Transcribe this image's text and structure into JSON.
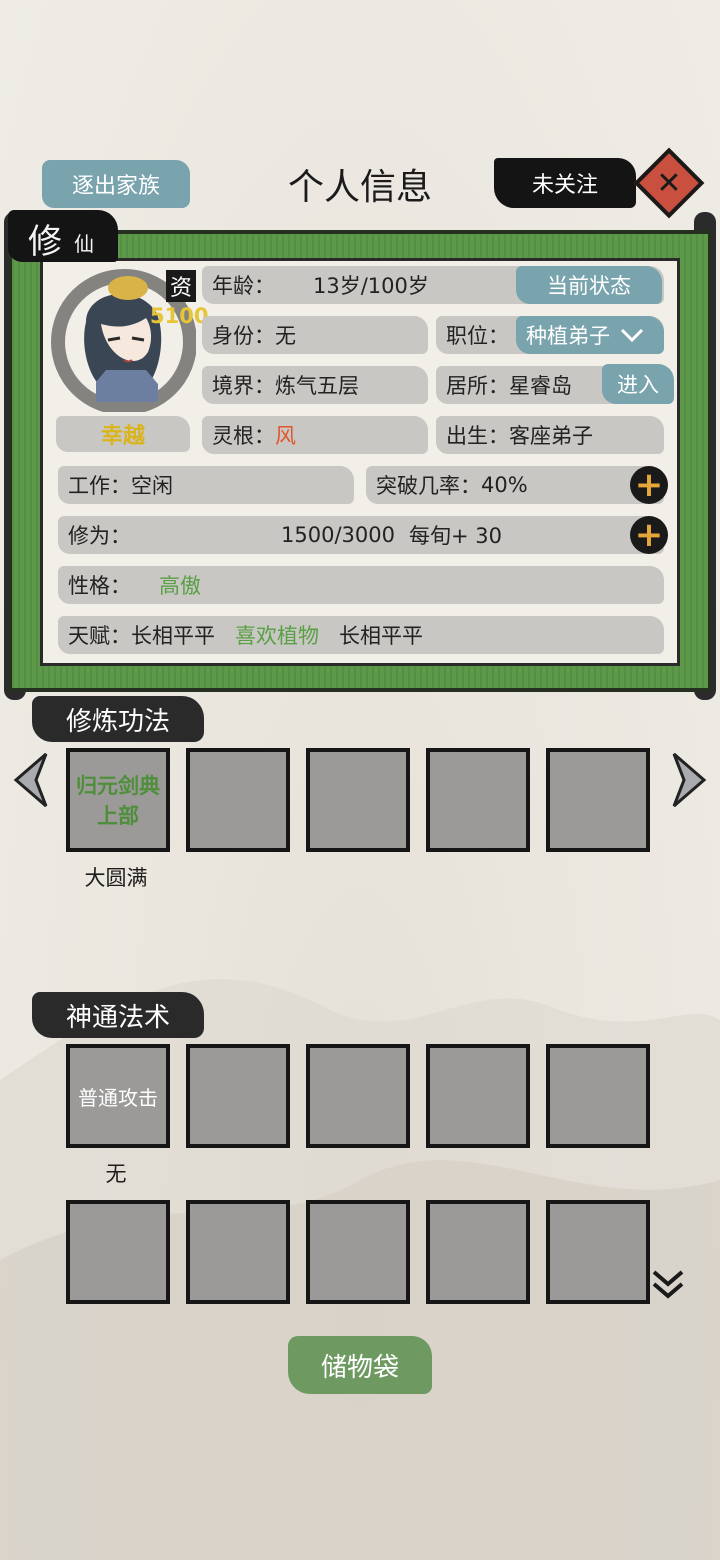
{
  "header": {
    "expel_label": "逐出家族",
    "title": "个人信息",
    "follow_label": "未关注"
  },
  "profile": {
    "tag_big": "修",
    "tag_small": "仙",
    "aptitude_label": "资",
    "aptitude_value": "5100",
    "name": "幸越",
    "age_label": "年龄：",
    "age_value": "13岁/100岁",
    "status_button": "当前状态",
    "identity_label": "身份：",
    "identity_value": "无",
    "position_label": "职位：",
    "position_value": "种植弟子",
    "realm_label": "境界：",
    "realm_value": "炼气五层",
    "residence_label": "居所：",
    "residence_value": "星睿岛",
    "enter_button": "进入",
    "root_label": "灵根：",
    "root_value": "风",
    "birth_label": "出生：",
    "birth_value": "客座弟子",
    "work_label": "工作：",
    "work_value": "空闲",
    "breakthrough_label": "突破几率：",
    "breakthrough_value": "40%",
    "cultivation_label": "修为：",
    "cultivation_value": "1500/3000",
    "cultivation_rate": "每旬+ 30",
    "personality_label": "性格：",
    "personality_value": "高傲",
    "talent_label": "天赋：",
    "talents": [
      "长相平平",
      "喜欢植物",
      "长相平平"
    ]
  },
  "techniques": {
    "title": "修炼功法",
    "slot1_line1": "归元剑典",
    "slot1_line2": "上部",
    "slot1_status": "大圆满"
  },
  "skills": {
    "title": "神通法术",
    "slot1_name": "普通攻击",
    "slot1_status": "无"
  },
  "storage_label": "储物袋",
  "colors": {
    "accent_teal": "#79a3ad",
    "scroll_green": "#5c9a4a",
    "gold": "#d9b41a",
    "root_red": "#e2552e",
    "good_green": "#5aa046"
  }
}
